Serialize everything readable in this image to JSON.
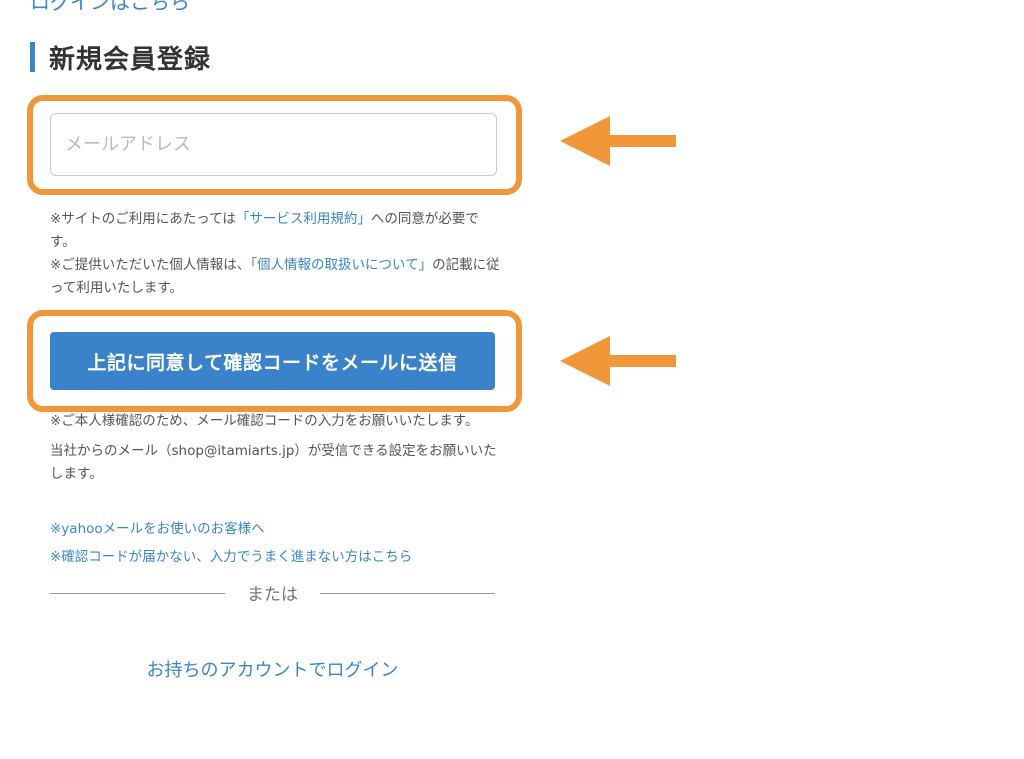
{
  "top_link": {
    "label": "ログインはこちら"
  },
  "section": {
    "title": "新規会員登録"
  },
  "email": {
    "placeholder": "メールアドレス",
    "value": ""
  },
  "consent": {
    "line1_prefix": "※サイトのご利用にあたっては",
    "terms_link": "「サービス利用規約」",
    "line1_suffix": "への同意が必要です。",
    "line2_prefix": "※ご提供いただいた個人情報は、",
    "privacy_link": "「個人情報の取扱いについて」",
    "line2_suffix": "の記載に従って利用いたします。"
  },
  "submit": {
    "label": "上記に同意して確認コードをメールに送信"
  },
  "confirm_notes": {
    "note1": "※ご本人様確認のため、メール確認コードの入力をお願いいたします。",
    "note2": "当社からのメール（shop@itamiarts.jp）が受信できる設定をお願いいたします。"
  },
  "links": {
    "yahoo": "※yahooメールをお使いのお客様へ",
    "code_help": "※確認コードが届かない、入力でうまく進まない方はこちら"
  },
  "divider": {
    "label": "または"
  },
  "login": {
    "label": "お持ちのアカウントでログイン"
  },
  "colors": {
    "accent": "#3a86cb",
    "button": "#3a82c9",
    "highlight": "#f0973a"
  },
  "icons": {
    "arrow": "arrow-left-icon"
  }
}
